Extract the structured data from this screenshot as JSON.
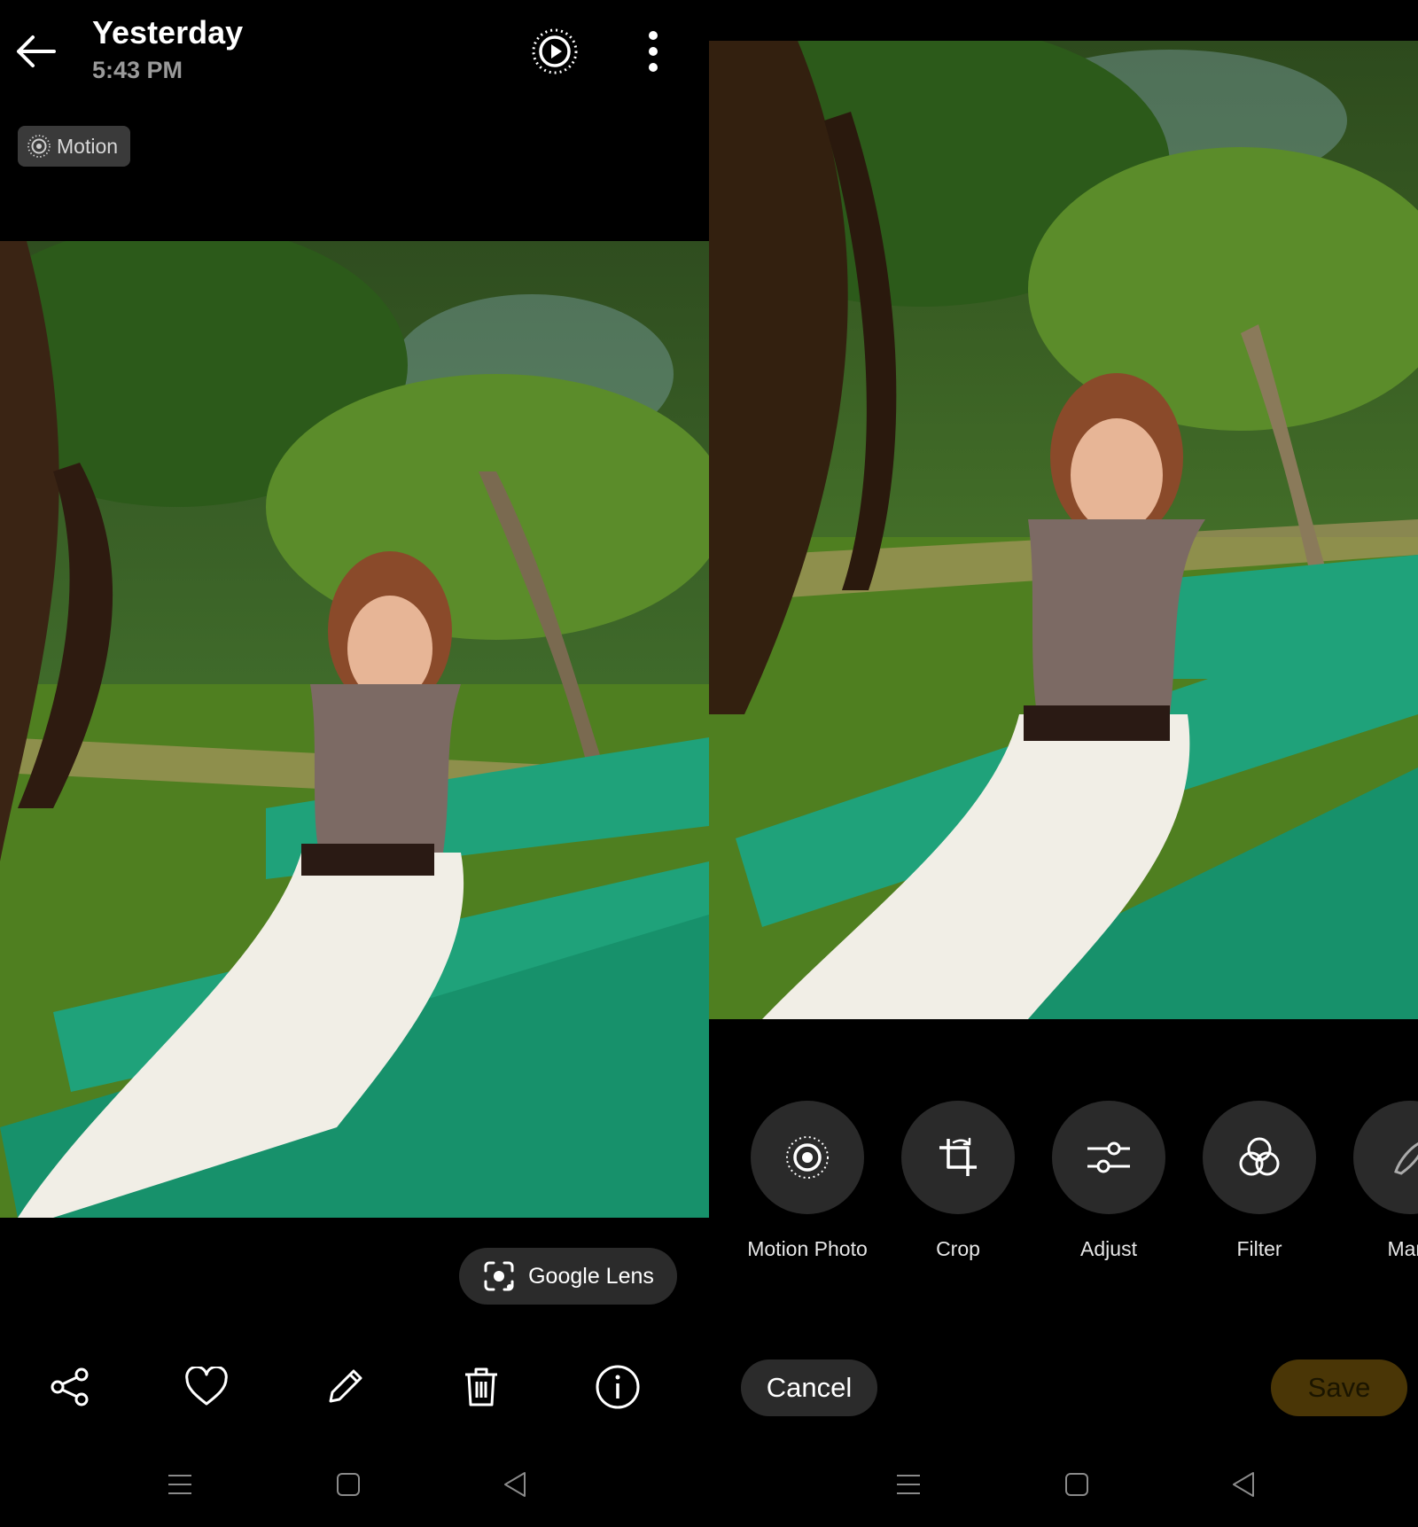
{
  "viewer": {
    "header": {
      "title": "Yesterday",
      "time": "5:43 PM",
      "back_icon": "arrow-left-icon",
      "motion_toggle_icon": "motion-play-icon",
      "more_icon": "more-vert-icon"
    },
    "motion_badge": {
      "label": "Motion",
      "icon": "motion-dot-icon"
    },
    "lens_button": {
      "label": "Google Lens",
      "icon": "google-lens-icon"
    },
    "actions": [
      {
        "name": "share",
        "icon": "share-icon"
      },
      {
        "name": "favorite",
        "icon": "heart-icon"
      },
      {
        "name": "edit",
        "icon": "pencil-icon"
      },
      {
        "name": "delete",
        "icon": "trash-icon"
      },
      {
        "name": "info",
        "icon": "info-icon"
      }
    ]
  },
  "editor": {
    "tools": [
      {
        "label": "Motion Photo",
        "icon": "motion-photo-icon"
      },
      {
        "label": "Crop",
        "icon": "crop-icon"
      },
      {
        "label": "Adjust",
        "icon": "sliders-icon"
      },
      {
        "label": "Filter",
        "icon": "filter-icon"
      },
      {
        "label": "Mark",
        "icon": "markup-icon"
      }
    ],
    "cancel_label": "Cancel",
    "save_label": "Save"
  },
  "system_nav": {
    "menu_icon": "menu-lines-icon",
    "home_icon": "home-square-icon",
    "back_icon": "back-triangle-icon"
  },
  "colors": {
    "bench_green": "#1fa27a",
    "save_bg": "#4a3606",
    "chip_bg": "#2b2b2b"
  }
}
